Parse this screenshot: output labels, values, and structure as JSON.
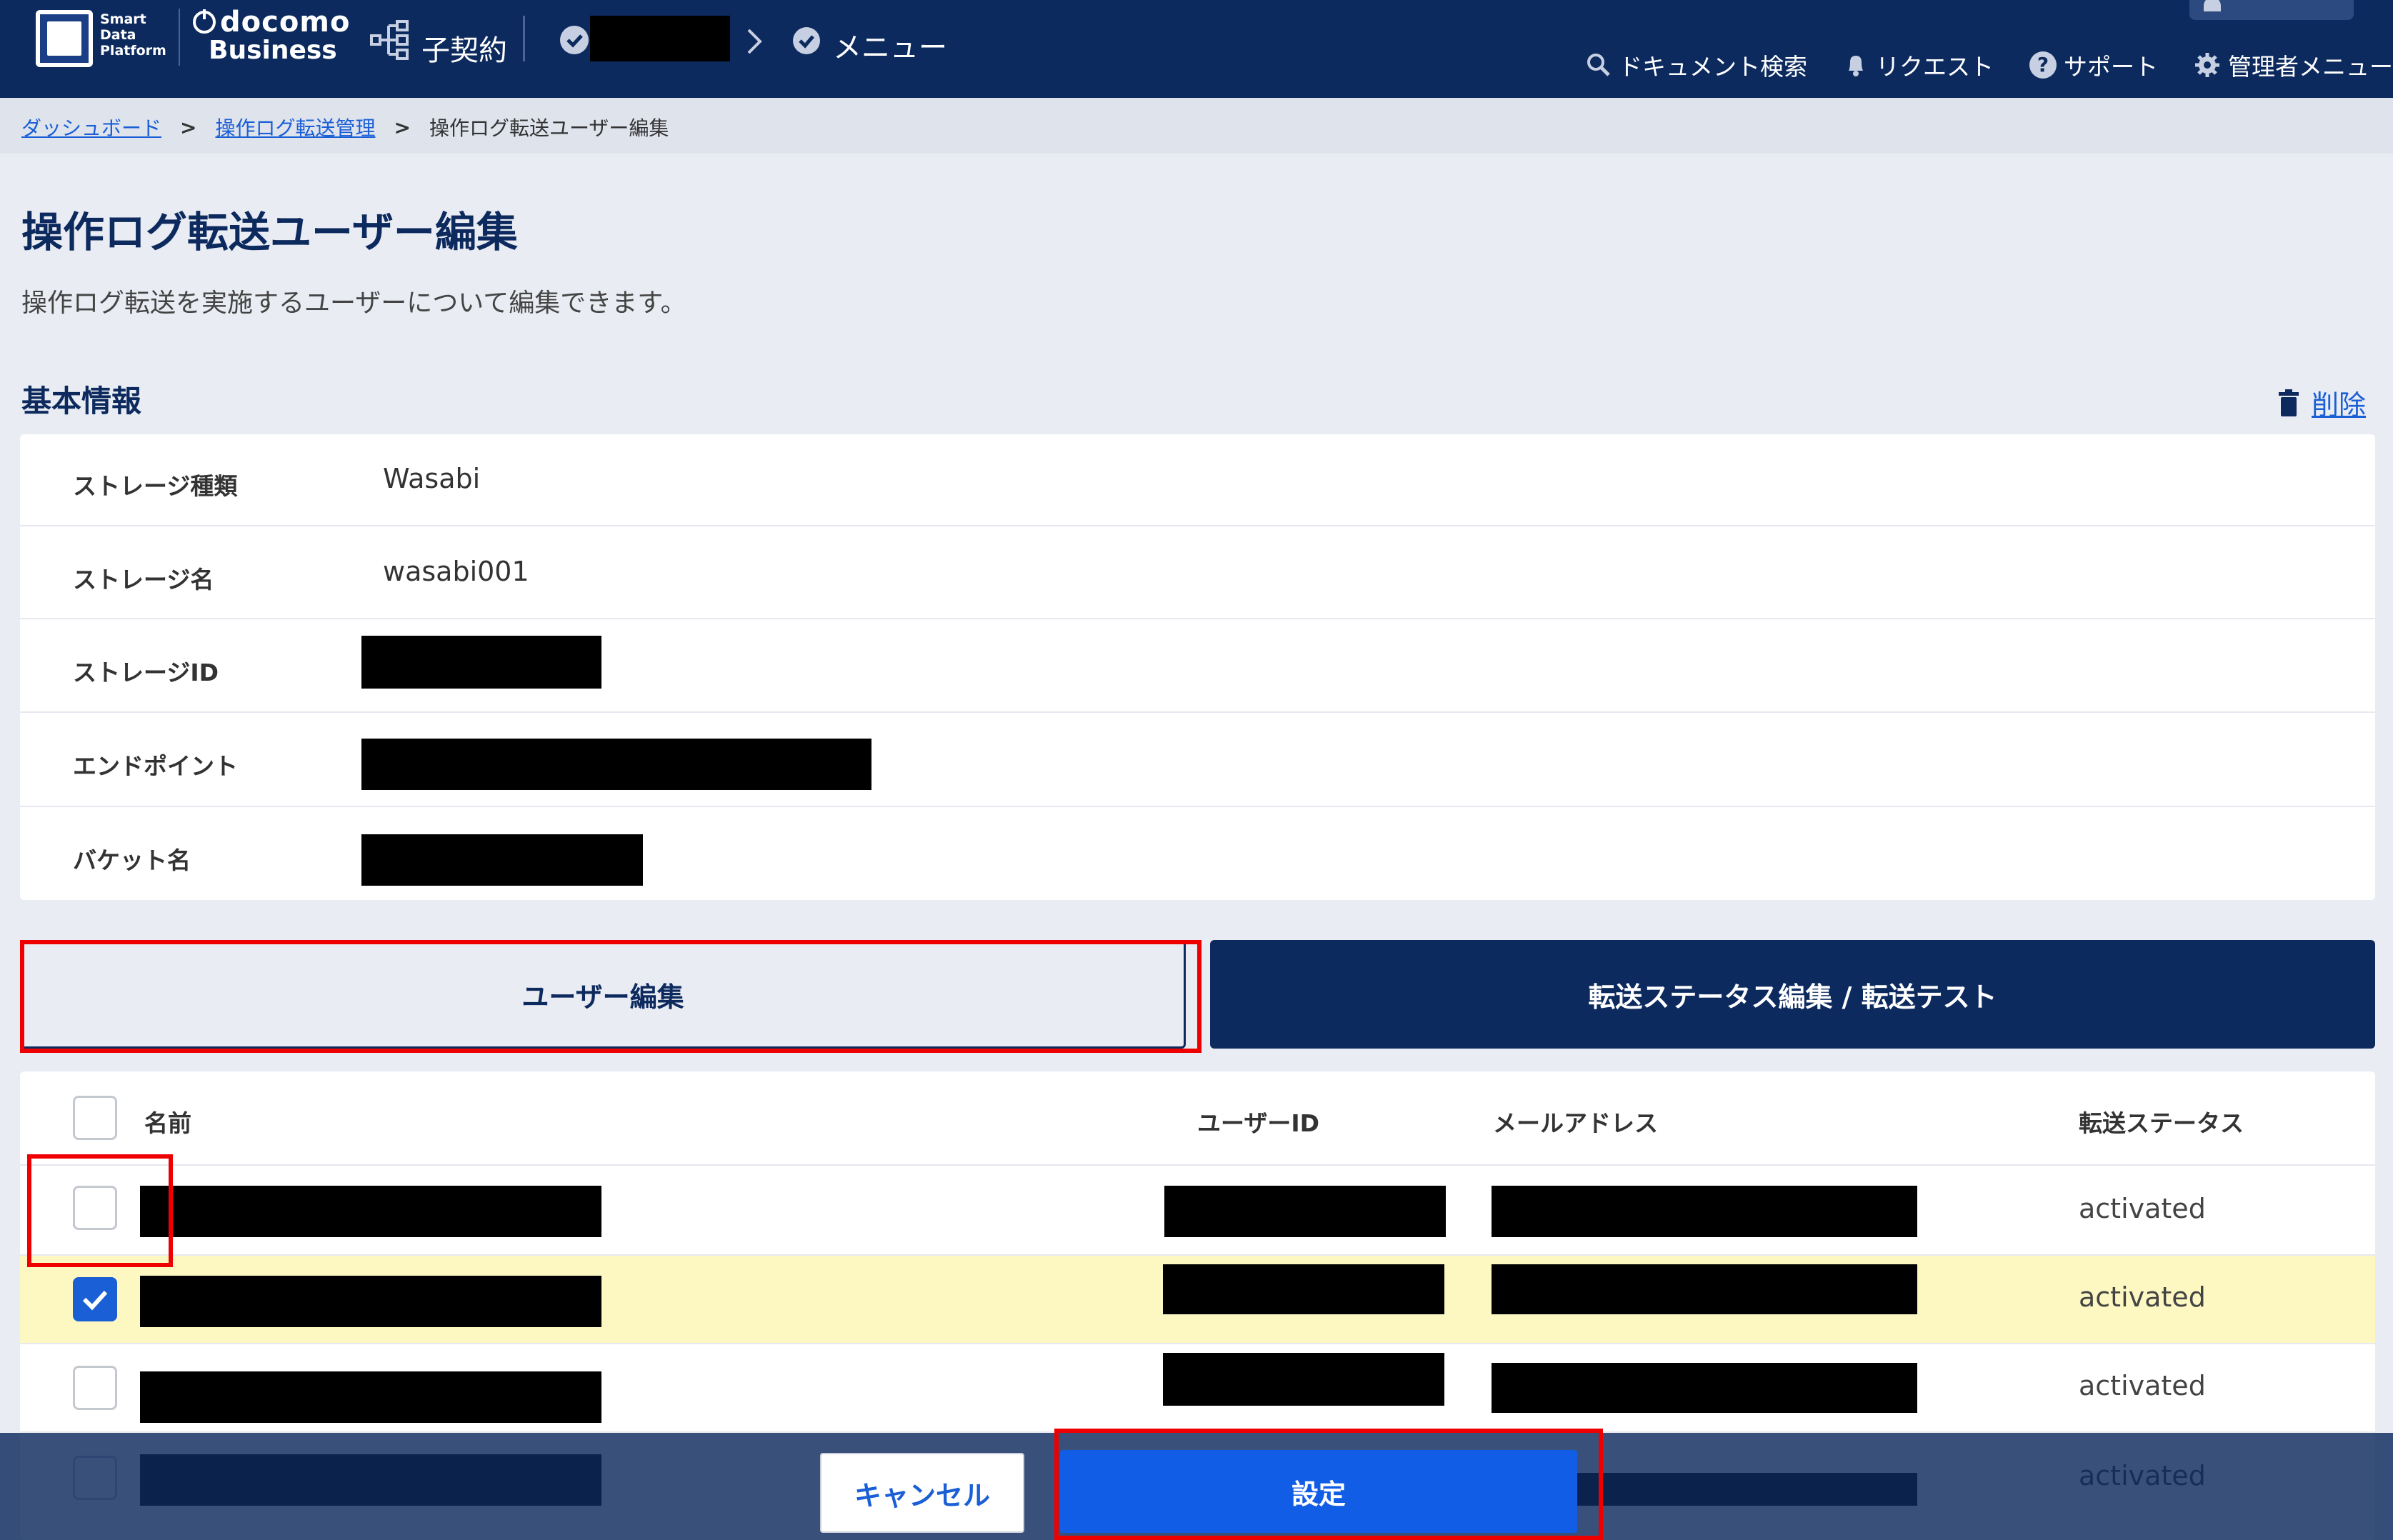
{
  "header": {
    "logo_smart": "Smart",
    "logo_data": "Data",
    "logo_platform": "Platform",
    "docomo": "docomo",
    "business": "Business",
    "contract_label": "子契約",
    "menu_label": "メニュー",
    "nav": [
      {
        "icon": "search-icon",
        "label": "ドキュメント検索"
      },
      {
        "icon": "bell-icon",
        "label": "リクエスト"
      },
      {
        "icon": "help-icon",
        "label": "サポート"
      },
      {
        "icon": "gear-icon",
        "label": "管理者メニュー"
      }
    ]
  },
  "breadcrumb": {
    "items": [
      "ダッシュボード",
      "操作ログ転送管理",
      "操作ログ転送ユーザー編集"
    ]
  },
  "page": {
    "title": "操作ログ転送ユーザー編集",
    "description": "操作ログ転送を実施するユーザーについて編集できます。",
    "section_title": "基本情報",
    "delete_label": "削除"
  },
  "info_rows": [
    {
      "label": "ストレージ種類",
      "value": "Wasabi"
    },
    {
      "label": "ストレージ名",
      "value": "wasabi001"
    },
    {
      "label": "ストレージID",
      "value": ""
    },
    {
      "label": "エンドポイント",
      "value": ""
    },
    {
      "label": "バケット名",
      "value": ""
    }
  ],
  "tabs": {
    "user_edit": "ユーザー編集",
    "transfer_edit": "転送ステータス編集 / 転送テスト"
  },
  "table": {
    "headers": {
      "name": "名前",
      "user_id": "ユーザーID",
      "email": "メールアドレス",
      "status": "転送ステータス"
    },
    "rows": [
      {
        "checked": false,
        "status": "activated"
      },
      {
        "checked": true,
        "status": "activated"
      },
      {
        "checked": false,
        "status": "activated"
      },
      {
        "checked": false,
        "status": "activated"
      }
    ]
  },
  "footer": {
    "cancel_label": "キャンセル",
    "submit_label": "設定"
  },
  "colors": {
    "header_bg": "#0d2a5e",
    "accent_blue": "#1a5fd6",
    "selected_row": "#fdf8c2",
    "highlight_red": "#e00000"
  }
}
